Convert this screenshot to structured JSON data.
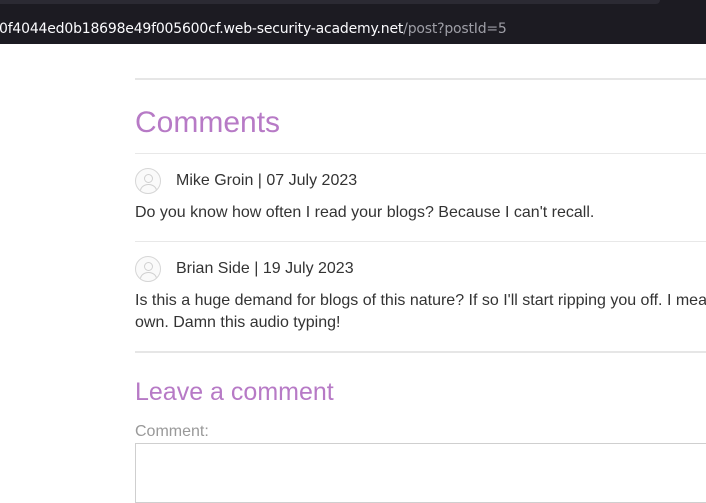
{
  "browser": {
    "url_host": "0f4044ed0b18698e49f005600cf.web-security-academy.net",
    "url_path": "/post?postId=5"
  },
  "comments_section": {
    "title": "Comments",
    "items": [
      {
        "author_line": "Mike Groin | 07 July 2023",
        "body": "Do you know how often I read your blogs? Because I can't recall."
      },
      {
        "author_line": "Brian Side | 19 July 2023",
        "body_line1": "Is this a huge demand for blogs of this nature? If so I'll start ripping you off. I mea",
        "body_line2": "own. Damn this audio typing!"
      }
    ]
  },
  "leave_comment": {
    "title": "Leave a comment",
    "comment_label": "Comment:"
  }
}
